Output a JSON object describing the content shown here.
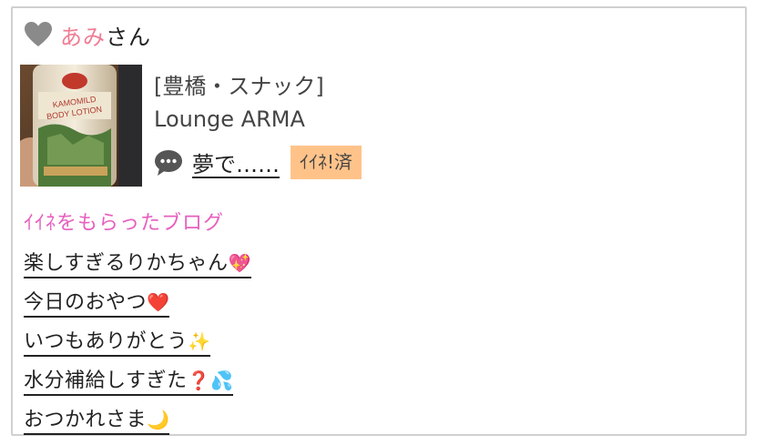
{
  "header": {
    "user_name": "あみ",
    "honorific": "さん",
    "icon": "heart-icon"
  },
  "shop": {
    "area": "[豊橋・スナック]",
    "name": "Lounge ARMA"
  },
  "post": {
    "title": "夢で……",
    "liked_badge": "ｲｲﾈ!済",
    "icon": "speech-bubble-icon"
  },
  "liked_blogs": {
    "title": "ｲｲﾈをもらったブログ",
    "items": [
      {
        "label": "楽しすぎるりかちゃん",
        "emoji": "💖"
      },
      {
        "label": "今日のおやつ",
        "emoji": "❤️"
      },
      {
        "label": "いつもありがとう",
        "emoji": "✨"
      },
      {
        "label": "水分補給しすぎた",
        "emoji": "❓💦"
      },
      {
        "label": "おつかれさま",
        "emoji": "🌙"
      }
    ]
  },
  "colors": {
    "name_pink": "#ef7d93",
    "section_pink": "#e75fbf",
    "badge_bg": "#ffc38a",
    "heart_gray": "#8a8a8a"
  }
}
